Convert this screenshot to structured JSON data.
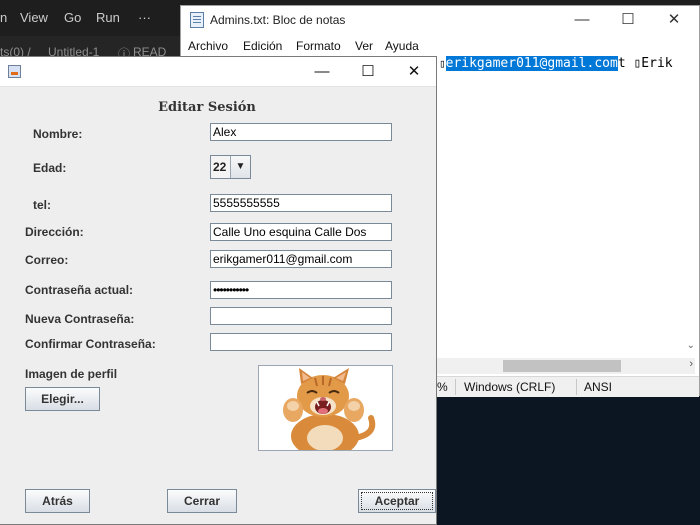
{
  "vscode": {
    "menu": [
      "n",
      "View",
      "Go",
      "Run",
      "···"
    ],
    "tabs": [
      "ts(0) /",
      "Untitled-1",
      "READ"
    ]
  },
  "notepad": {
    "title": "Admins.txt: Bloc de notas",
    "menu": [
      "Archivo",
      "Edición",
      "Formato",
      "Ver",
      "Ayuda"
    ],
    "text_before": "",
    "text_selected": "erikgamer011@gmail.com",
    "text_after": "t \u0000Erik",
    "status_fragment": "%",
    "line_ending": "Windows (CRLF)",
    "encoding": "ANSI"
  },
  "dialog": {
    "heading": "Editar Sesión",
    "labels": {
      "nombre": "Nombre:",
      "edad": "Edad:",
      "tel": "tel:",
      "direccion": "Dirección:",
      "correo": "Correo:",
      "contrasena_actual": "Contraseña actual:",
      "nueva_contrasena": "Nueva Contraseña:",
      "confirmar_contrasena": "Confirmar Contraseña:",
      "imagen_perfil": "Imagen de perfil"
    },
    "values": {
      "nombre": "Alex",
      "edad": "22",
      "tel": "5555555555",
      "direccion": "Calle Uno esquina Calle Dos",
      "correo": "erikgamer011@gmail.com",
      "contrasena_actual": "•••••••••••",
      "nueva_contrasena": "",
      "confirmar_contrasena": ""
    },
    "buttons": {
      "elegir": "Elegir...",
      "atras": "Atrás",
      "cerrar": "Cerrar",
      "aceptar": "Aceptar"
    }
  }
}
